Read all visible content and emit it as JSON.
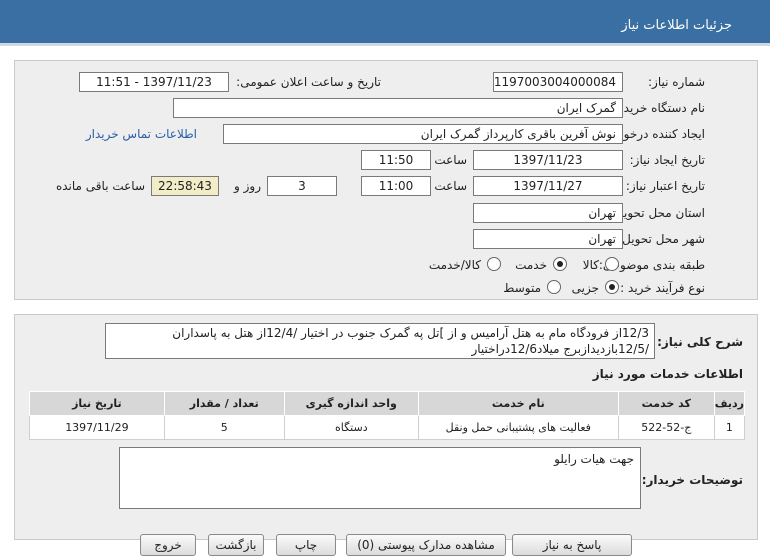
{
  "header": {
    "title": "جزئیات اطلاعات نیاز"
  },
  "form": {
    "need_number_label": "شماره نیاز:",
    "need_number": "1197003004000084",
    "announce_label": "تاریخ و ساعت اعلان عمومی:",
    "announce_value": "1397/11/23 - 11:51",
    "buyer_org_label": "نام دستگاه خریدار:",
    "buyer_org": "گمرک ایران",
    "requester_label": "ایجاد کننده درخواست:",
    "requester": "نوش آفرین باقری کارپرداز گمرک ایران",
    "contact_link": "اطلاعات تماس خریدار",
    "created_label": "تاریخ ایجاد نیاز:",
    "created_date": "1397/11/23",
    "time_label": "ساعت",
    "created_time": "11:50",
    "valid_label": "تاریخ اعتبار نیاز:",
    "valid_date": "1397/11/27",
    "valid_time": "11:00",
    "days_value": "3",
    "days_label": "روز و",
    "remaining_time": "22:58:43",
    "remaining_label": "ساعت باقی مانده",
    "province_label": "استان محل تحویل:",
    "province": "تهران",
    "city_label": "شهر محل تحویل:",
    "city": "تهران",
    "category_label": "طبقه بندی موضوعی:",
    "category_options": [
      "کالا",
      "خدمت",
      "کالا/خدمت"
    ],
    "process_label": "نوع فرآیند خرید :",
    "process_options": [
      "جزیی",
      "متوسط"
    ]
  },
  "details": {
    "desc_label": "شرح کلی نیاز:",
    "desc_line1": "12/3از فرودگاه مام به هتل آرامیس و از ]تل په گمرک جنوب در اختیار /12/4از هتل به پاسداران",
    "desc_line2": "/12/5بازدیدازبرج میلاد12/6دراختیار",
    "services_title": "اطلاعات خدمات مورد نیاز",
    "columns": [
      "ردیف",
      "کد خدمت",
      "نام خدمت",
      "واحد اندازه گیری",
      "تعداد / مقدار",
      "تاریخ نیاز"
    ],
    "rows": [
      [
        "1",
        "ج-52-522",
        "فعالیت های پشتیبانی حمل ونقل",
        "دستگاه",
        "5",
        "1397/11/29"
      ]
    ],
    "notes_label": "توضیحات خریدار:",
    "notes": "جهت هیات رایلو"
  },
  "buttons": {
    "reply": "پاسخ به نیاز",
    "attachments": "مشاهده مدارک پیوستی (0)",
    "print": "چاپ",
    "back": "بازگشت",
    "exit": "خروج"
  }
}
